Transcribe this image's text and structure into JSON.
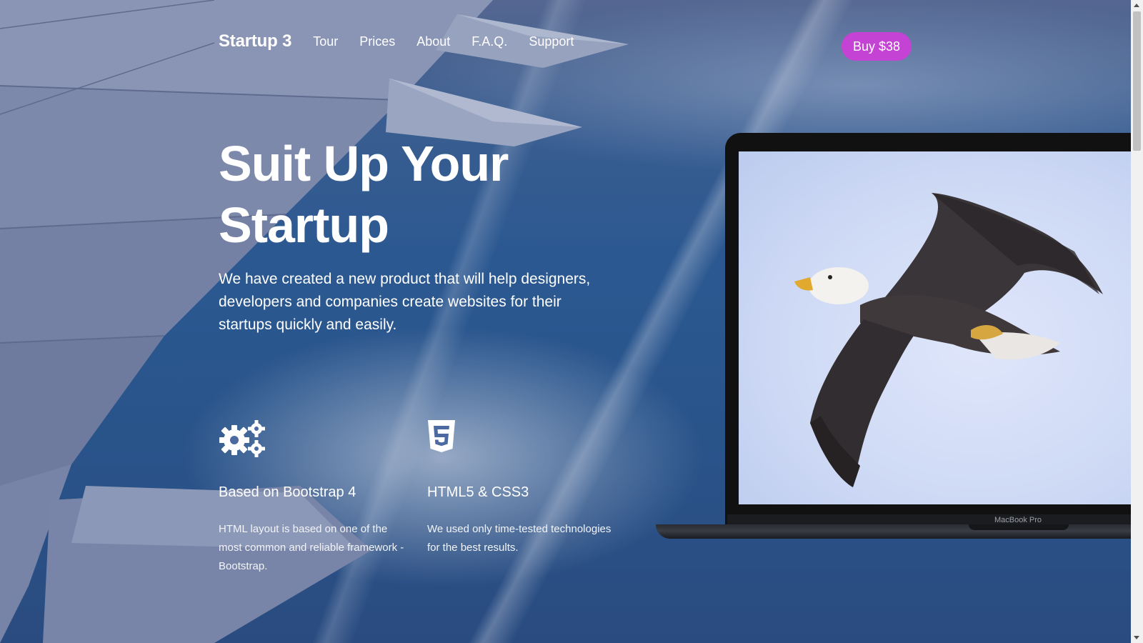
{
  "nav": {
    "brand": "Startup 3",
    "links": [
      "Tour",
      "Prices",
      "About",
      "F.A.Q.",
      "Support"
    ],
    "buy_label": "Buy $38"
  },
  "hero": {
    "title_line1": "Suit Up Your",
    "title_line2": "Startup",
    "text": "We have created a new product that will help designers, developers and companies create websites for their startups quickly and easily."
  },
  "features": [
    {
      "icon": "gears-icon",
      "title": "Based on Bootstrap 4",
      "text": "HTML layout is based on one of the most common and reliable framework - Bootstrap."
    },
    {
      "icon": "html5-icon",
      "title": "HTML5 & CSS3",
      "text": "We used only time-tested technologies for the best results."
    }
  ],
  "laptop": {
    "model_label": "MacBook Pro",
    "screen_image": "bald-eagle-image"
  },
  "colors": {
    "accent": "#c543d4",
    "text": "#ffffff",
    "background": "#2a5589"
  }
}
